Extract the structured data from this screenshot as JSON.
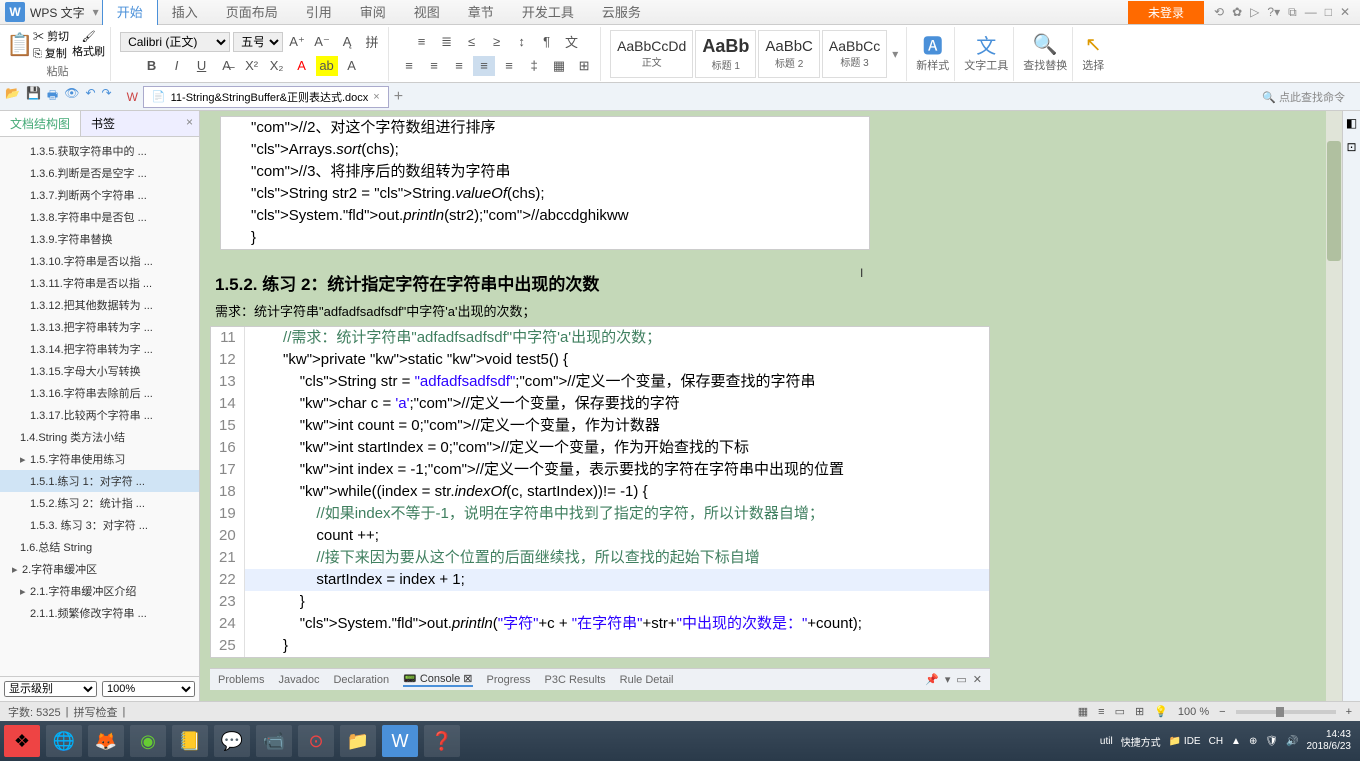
{
  "app": {
    "name": "WPS 文字",
    "login": "未登录"
  },
  "menu": [
    "开始",
    "插入",
    "页面布局",
    "引用",
    "审阅",
    "视图",
    "章节",
    "开发工具",
    "云服务"
  ],
  "ribbon": {
    "paste": "粘贴",
    "cut": "剪切",
    "copy": "复制",
    "format": "格式刷",
    "font": "Calibri (正文)",
    "size": "五号",
    "styles": [
      {
        "p": "AaBbCcDd",
        "l": "正文"
      },
      {
        "p": "AaBb",
        "l": "标题 1"
      },
      {
        "p": "AaBbC",
        "l": "标题 2"
      },
      {
        "p": "AaBbCc",
        "l": "标题 3"
      }
    ],
    "newstyle": "新样式",
    "texttools": "文字工具",
    "findreplace": "查找替换",
    "select": "选择"
  },
  "doctab": "11-String&StringBuffer&正则表达式.docx",
  "searchcmd": "点此查找命令",
  "sidebar": {
    "tab1": "文档结构图",
    "tab2": "书签",
    "items": [
      {
        "t": "1.3.5.获取字符串中的 ...",
        "l": 3
      },
      {
        "t": "1.3.6.判断是否是空字 ...",
        "l": 3
      },
      {
        "t": "1.3.7.判断两个字符串 ...",
        "l": 3
      },
      {
        "t": "1.3.8.字符串中是否包 ...",
        "l": 3
      },
      {
        "t": "1.3.9.字符串替换",
        "l": 3
      },
      {
        "t": "1.3.10.字符串是否以指 ...",
        "l": 3
      },
      {
        "t": "1.3.11.字符串是否以指 ...",
        "l": 3
      },
      {
        "t": "1.3.12.把其他数据转为 ...",
        "l": 3
      },
      {
        "t": "1.3.13.把字符串转为字 ...",
        "l": 3
      },
      {
        "t": "1.3.14.把字符串转为字 ...",
        "l": 3
      },
      {
        "t": "1.3.15.字母大小写转换",
        "l": 3
      },
      {
        "t": "1.3.16.字符串去除前后 ...",
        "l": 3
      },
      {
        "t": "1.3.17.比较两个字符串 ...",
        "l": 3
      },
      {
        "t": "1.4.String 类方法小结",
        "l": 2
      },
      {
        "t": "1.5.字符串使用练习",
        "l": 2,
        "e": true
      },
      {
        "t": "1.5.1.练习 1：对字符 ...",
        "l": 3,
        "a": true
      },
      {
        "t": "1.5.2.练习 2：统计指 ...",
        "l": 3
      },
      {
        "t": "1.5.3. 练习 3：对字符 ...",
        "l": 3
      },
      {
        "t": "1.6.总结 String",
        "l": 2
      },
      {
        "t": "2.字符串缓冲区",
        "l": 1,
        "e": true
      },
      {
        "t": "2.1.字符串缓冲区介绍",
        "l": 2,
        "e": true
      },
      {
        "t": "2.1.1.频繁修改字符串 ...",
        "l": 3
      }
    ],
    "level": "显示级别",
    "zoom": "100%"
  },
  "doc": {
    "code1": [
      "//2、对这个字符数组进行排序",
      "Arrays.sort(chs);",
      "//3、将排序后的数组转为字符串",
      "String str2 = String.valueOf(chs);",
      "System.out.println(str2);//abccdghikww",
      "}"
    ],
    "heading": "1.5.2. 练习 2：统计指定字符在字符串中出现的次数",
    "req": "需求：统计字符串\"adfadfsadfsdf\"中字符'a'出现的次数；",
    "gutter": [
      "11",
      "12",
      "13",
      "14",
      "15",
      "16",
      "17",
      "18",
      "19",
      "20",
      "21",
      "22",
      "23",
      "24",
      "25"
    ],
    "code2": [
      {
        "t": "        //需求：统计字符串\"adfadfsadfsdf\"中字符'a'出现的次数；",
        "c": "com"
      },
      {
        "t": "        private static void test5() {",
        "c": "kw"
      },
      {
        "t": "            String str = \"adfadfsadfsdf\";//定义一个变量，保存要查找的字符串"
      },
      {
        "t": "            char c = 'a';//定义一个变量，保存要找的字符"
      },
      {
        "t": "            int count = 0;//定义一个变量，作为计数器"
      },
      {
        "t": "            int startIndex = 0;//定义一个变量，作为开始查找的下标"
      },
      {
        "t": "            int index = -1;//定义一个变量，表示要找的字符在字符串中出现的位置"
      },
      {
        "t": "            while((index = str.indexOf(c, startIndex))!= -1) {"
      },
      {
        "t": "                //如果index不等于-1，说明在字符串中找到了指定的字符，所以计数器自增；",
        "c": "com"
      },
      {
        "t": "                count ++;"
      },
      {
        "t": "                //接下来因为要从这个位置的后面继续找，所以查找的起始下标自增",
        "c": "com"
      },
      {
        "t": "                startIndex = index + 1;",
        "hl": true
      },
      {
        "t": "            }"
      },
      {
        "t": "            System.out.println(\"字符\"+c + \"在字符串\"+str+\"中出现的次数是：\"+count);"
      },
      {
        "t": "        }"
      }
    ],
    "bottom_tabs": [
      "Problems",
      "Javadoc",
      "Declaration",
      "Console",
      "Progress",
      "P3C Results",
      "Rule Detail"
    ]
  },
  "status": {
    "words": "字数: 5325",
    "spell": "拼写检查",
    "zoom": "100 %"
  },
  "taskbar": {
    "util": "util",
    "shortcut": "快捷方式",
    "ide": "IDE",
    "ime": "CH",
    "time": "14:43",
    "date": "2018/6/23"
  }
}
